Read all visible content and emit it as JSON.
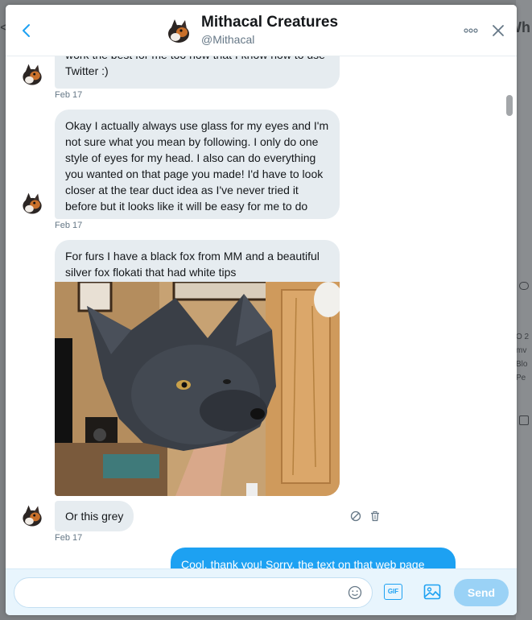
{
  "background": {
    "left_text": "<",
    "right_text": "Wh",
    "right_meta": [
      "O 2",
      "mv",
      "Blo",
      "Pe"
    ]
  },
  "header": {
    "name": "Mithacal Creatures",
    "handle": "@Mithacal",
    "back_icon": "chevron-left-icon",
    "more_icon": "more-dots-icon",
    "close_icon": "close-icon"
  },
  "messages": [
    {
      "id": "m1",
      "text": "work the best for me too now that I know how to use Twitter :)",
      "date": "Feb 17"
    },
    {
      "id": "m2",
      "text": "Okay I actually always use glass for my eyes and I'm not sure what you mean by following. I only do one style of eyes for my head. I also can do everything you wanted on that page you made! I'd have to look closer at the tear duct idea as I've never tried it before but it looks like it will be easy for me to do",
      "date": "Feb 17"
    },
    {
      "id": "m3",
      "text": "For furs I have a black fox from MM and a beautiful silver fox flokati that had white tips",
      "image": "photo of grey furry fox head"
    },
    {
      "id": "m4",
      "text": "Or this grey",
      "date": "Feb 17"
    }
  ],
  "outgoing": {
    "text": "Cool, thank you! Sorry, the text on that web page"
  },
  "composer": {
    "placeholder": "",
    "gif_label": "GIF",
    "send_label": "Send"
  },
  "colors": {
    "accent": "#1da1f2",
    "bubble_in": "#e6ecf0",
    "send_disabled": "#9ad2f6"
  }
}
